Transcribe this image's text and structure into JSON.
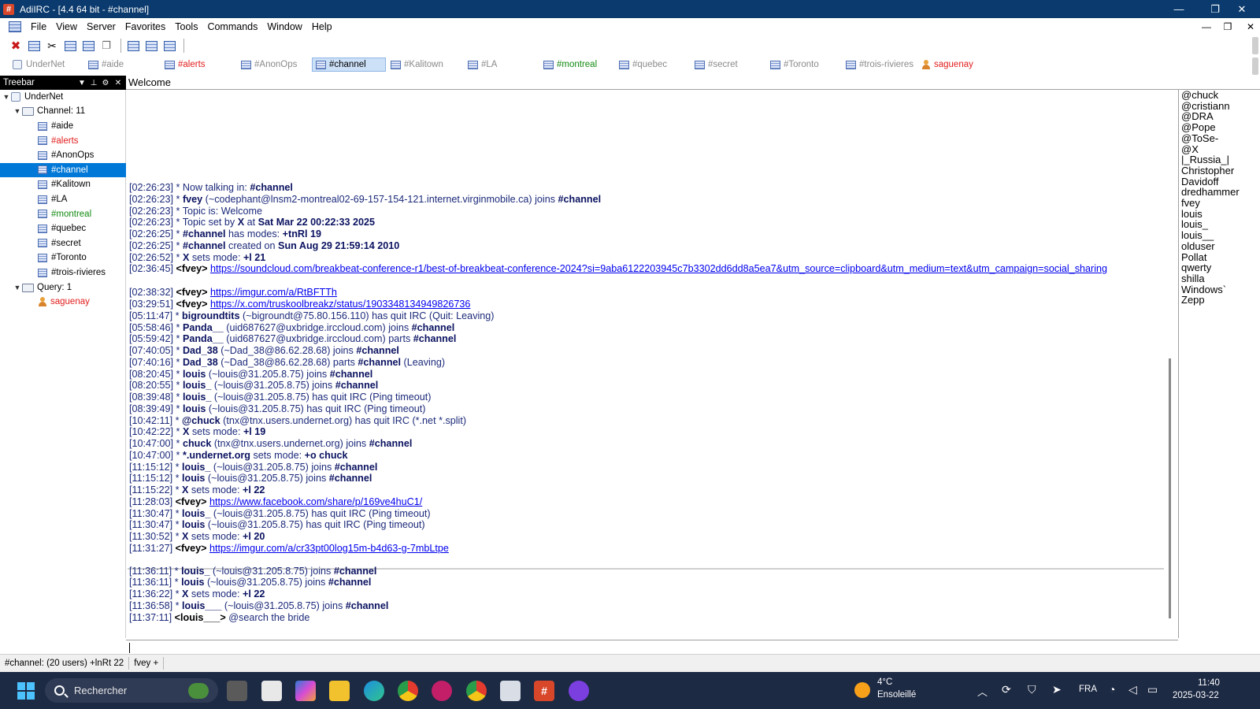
{
  "window": {
    "title": "AdiIRC - [4.4 64 bit - #channel]",
    "app_glyph": "#",
    "btn_minimize": "—",
    "btn_maximize": "❐",
    "btn_close": "✕"
  },
  "menu": {
    "items": [
      "File",
      "View",
      "Server",
      "Favorites",
      "Tools",
      "Commands",
      "Window",
      "Help"
    ],
    "mdi_min": "—",
    "mdi_restore": "❐",
    "mdi_close": "✕"
  },
  "switchbar": {
    "tabs": [
      {
        "label": "UnderNet",
        "color": "#8a8a8a",
        "kind": "network"
      },
      {
        "label": "#aide",
        "color": "#8a8a8a",
        "kind": "channel"
      },
      {
        "label": "#alerts",
        "color": "#e21d1d",
        "kind": "channel"
      },
      {
        "label": "#AnonOps",
        "color": "#8a8a8a",
        "kind": "channel"
      },
      {
        "label": "#channel",
        "color": "#000000",
        "kind": "channel",
        "active": true
      },
      {
        "label": "#Kalitown",
        "color": "#8a8a8a",
        "kind": "channel"
      },
      {
        "label": "#LA",
        "color": "#8a8a8a",
        "kind": "channel"
      },
      {
        "label": "#montreal",
        "color": "#128a12",
        "kind": "channel"
      },
      {
        "label": "#quebec",
        "color": "#8a8a8a",
        "kind": "channel"
      },
      {
        "label": "#secret",
        "color": "#8a8a8a",
        "kind": "channel"
      },
      {
        "label": "#Toronto",
        "color": "#8a8a8a",
        "kind": "channel"
      },
      {
        "label": "#trois-rivieres",
        "color": "#8a8a8a",
        "kind": "channel"
      },
      {
        "label": "saguenay",
        "color": "#e21d1d",
        "kind": "query"
      }
    ]
  },
  "treebar": {
    "title": "Treebar",
    "network": "UnderNet",
    "channel_group": "Channel: 11",
    "channels": [
      {
        "label": "#aide",
        "color": "#000000"
      },
      {
        "label": "#alerts",
        "color": "#e21d1d"
      },
      {
        "label": "#AnonOps",
        "color": "#000000"
      },
      {
        "label": "#channel",
        "color": "#ffffff",
        "selected": true
      },
      {
        "label": "#Kalitown",
        "color": "#000000"
      },
      {
        "label": "#LA",
        "color": "#000000"
      },
      {
        "label": "#montreal",
        "color": "#128a12"
      },
      {
        "label": "#quebec",
        "color": "#000000"
      },
      {
        "label": "#secret",
        "color": "#000000"
      },
      {
        "label": "#Toronto",
        "color": "#000000"
      },
      {
        "label": "#trois-rivieres",
        "color": "#000000"
      }
    ],
    "query_group": "Query: 1",
    "queries": [
      {
        "label": "saguenay",
        "color": "#e21d1d"
      }
    ]
  },
  "topic": "Welcome",
  "chat": {
    "lines": [
      {
        "ts": "[02:26:23]",
        "html": " * Now talking in: <b>#channel</b>"
      },
      {
        "ts": "[02:26:23]",
        "html": " * <b>fvey</b> (~codephant@lnsm2-montreal02-69-157-154-121.internet.virginmobile.ca) joins <b>#channel</b>"
      },
      {
        "ts": "[02:26:23]",
        "html": " * Topic is: Welcome"
      },
      {
        "ts": "[02:26:23]",
        "html": " * Topic set by <b>X</b> at <b>Sat Mar 22 00:22:33 2025</b>"
      },
      {
        "ts": "[02:26:25]",
        "html": " * <b>#channel</b> has modes: <b>+tnRl 19</b>"
      },
      {
        "ts": "[02:26:25]",
        "html": " * <b>#channel</b> created on <b>Sun Aug 29 21:59:14 2010</b>"
      },
      {
        "ts": "[02:26:52]",
        "html": " * <b>X</b> sets mode: <b>+l 21</b>"
      },
      {
        "ts": "[02:36:45]",
        "html": " <span class=\"nick\">&lt;fvey&gt;</span> <a>https://soundcloud.com/breakbeat-conference-r1/best-of-breakbeat-conference-2024?si=9aba6122203945c7b3302dd6dd8a5ea7&amp;utm_source=clipboard&amp;utm_medium=text&amp;utm_campaign=social_sharing</a>",
        "wrap": true
      },
      {
        "ts": "[02:38:32]",
        "html": " <span class=\"nick\">&lt;fvey&gt;</span> <a>https://imgur.com/a/RtBFTTh</a>"
      },
      {
        "ts": "[03:29:51]",
        "html": " <span class=\"nick\">&lt;fvey&gt;</span> <a>https://x.com/truskoolbreakz/status/1903348134949826736</a>"
      },
      {
        "ts": "[05:11:47]",
        "html": " * <b>bigroundtits</b> (~bigroundt@75.80.156.110) has quit IRC (Quit: Leaving)"
      },
      {
        "ts": "[05:58:46]",
        "html": " * <b>Panda__</b> (uid687627@uxbridge.irccloud.com) joins <b>#channel</b>"
      },
      {
        "ts": "[05:59:42]",
        "html": " * <b>Panda__</b> (uid687627@uxbridge.irccloud.com) parts <b>#channel</b>"
      },
      {
        "ts": "[07:40:05]",
        "html": " * <b>Dad_38</b> (~Dad_38@86.62.28.68) joins <b>#channel</b>"
      },
      {
        "ts": "[07:40:16]",
        "html": " * <b>Dad_38</b> (~Dad_38@86.62.28.68) parts <b>#channel</b> (Leaving)"
      },
      {
        "ts": "[08:20:45]",
        "html": " * <b>louis</b> (~louis@31.205.8.75) joins <b>#channel</b>"
      },
      {
        "ts": "[08:20:55]",
        "html": " * <b>louis_</b> (~louis@31.205.8.75) joins <b>#channel</b>"
      },
      {
        "ts": "[08:39:48]",
        "html": " * <b>louis_</b> (~louis@31.205.8.75) has quit IRC (Ping timeout)"
      },
      {
        "ts": "[08:39:49]",
        "html": " * <b>louis</b> (~louis@31.205.8.75) has quit IRC (Ping timeout)"
      },
      {
        "ts": "[10:42:11]",
        "html": " * <b>@chuck</b> (tnx@tnx.users.undernet.org) has quit IRC (*.net *.split)"
      },
      {
        "ts": "[10:42:22]",
        "html": " * <b>X</b> sets mode: <b>+l 19</b>"
      },
      {
        "ts": "[10:47:00]",
        "html": " * <b>chuck</b> (tnx@tnx.users.undernet.org) joins <b>#channel</b>"
      },
      {
        "ts": "[10:47:00]",
        "html": " * <b>*.undernet.org</b> sets mode: <b>+o chuck</b>"
      },
      {
        "ts": "[11:15:12]",
        "html": " * <b>louis_</b> (~louis@31.205.8.75) joins <b>#channel</b>"
      },
      {
        "ts": "[11:15:12]",
        "html": " * <b>louis</b> (~louis@31.205.8.75) joins <b>#channel</b>"
      },
      {
        "ts": "[11:15:22]",
        "html": " * <b>X</b> sets mode: <b>+l 22</b>"
      },
      {
        "ts": "[11:28:03]",
        "html": " <span class=\"nick\">&lt;fvey&gt;</span> <a>https://www.facebook.com/share/p/169ve4huC1/</a>"
      },
      {
        "ts": "[11:30:47]",
        "html": " * <b>louis_</b> (~louis@31.205.8.75) has quit IRC (Ping timeout)"
      },
      {
        "ts": "[11:30:47]",
        "html": " * <b>louis</b> (~louis@31.205.8.75) has quit IRC (Ping timeout)"
      },
      {
        "ts": "[11:30:52]",
        "html": " * <b>X</b> sets mode: <b>+l 20</b>"
      },
      {
        "ts": "[11:31:27]",
        "html": " <span class=\"nick\">&lt;fvey&gt;</span> <a>https://imgur.com/a/cr33pt00log15m-b4d63-g-7mbLtpe</a>"
      },
      {
        "ts": "[11:36:11]",
        "html": " * <b>louis_</b> (~louis@31.205.8.75) joins <b>#channel</b>",
        "after_marker": true
      },
      {
        "ts": "[11:36:11]",
        "html": " * <b>louis</b> (~louis@31.205.8.75) joins <b>#channel</b>"
      },
      {
        "ts": "[11:36:22]",
        "html": " * <b>X</b> sets mode: <b>+l 22</b>"
      },
      {
        "ts": "[11:36:58]",
        "html": " * <b>louis___</b> (~louis@31.205.8.75) joins <b>#channel</b>"
      },
      {
        "ts": "[11:37:11]",
        "html": " <span class=\"nick\">&lt;louis___&gt;</span> @search the bride"
      }
    ]
  },
  "nicklist": [
    "@chuck",
    "@cristiann",
    "@DRA",
    "@Pope",
    "@ToSe-",
    "@X",
    "|_Russia_|",
    "Christopher",
    "Davidoff",
    "dredhammer",
    "fvey",
    "louis",
    "louis_",
    "louis__",
    "olduser",
    "Pollat",
    "qwerty",
    "shilla",
    "Windows`",
    "Zepp"
  ],
  "statusbar": {
    "channel_info": "#channel: (20 users) +lnRt 22",
    "nick_info": "fvey +"
  },
  "taskbar": {
    "search_placeholder": "Rechercher",
    "weather_temp": "4°C",
    "weather_desc": "Ensoleillé",
    "lang": "FRA",
    "time": "11:40",
    "date": "2025-03-22"
  }
}
